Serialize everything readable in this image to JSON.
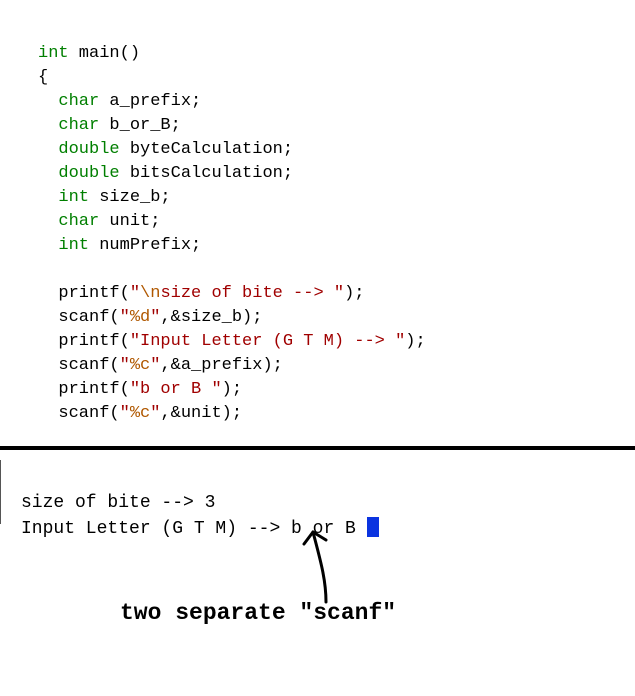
{
  "code": {
    "l1": {
      "type": "int",
      "rest": " main()"
    },
    "l2": "{",
    "l3": {
      "type": "char",
      "rest": " a_prefix;"
    },
    "l4": {
      "type": "char",
      "rest": " b_or_B;"
    },
    "l5": {
      "type": "double",
      "rest": " byteCalculation;"
    },
    "l6": {
      "type": "double",
      "rest": " bitsCalculation;"
    },
    "l7": {
      "type": "int",
      "rest": " size_b;"
    },
    "l8": {
      "type": "char",
      "rest": " unit;"
    },
    "l9": {
      "type": "int",
      "rest": " numPrefix;"
    },
    "l10": {
      "fn": "printf",
      "open": "(",
      "q1": "\"",
      "esc1": "\\n",
      "str1": "size of bite --> ",
      "q2": "\"",
      "close": ");"
    },
    "l11": {
      "fn": "scanf",
      "open": "(",
      "q1": "\"",
      "fmt": "%d",
      "q2": "\"",
      "rest": ",&size_b);"
    },
    "l12": {
      "fn": "printf",
      "open": "(",
      "q1": "\"",
      "str1": "Input Letter (G T M) --> ",
      "q2": "\"",
      "close": ");"
    },
    "l13": {
      "fn": "scanf",
      "open": "(",
      "q1": "\"",
      "fmt": "%c",
      "q2": "\"",
      "rest": ",&a_prefix);"
    },
    "l14": {
      "fn": "printf",
      "open": "(",
      "q1": "\"",
      "str1": "b or B ",
      "q2": "\"",
      "close": ");"
    },
    "l15": {
      "fn": "scanf",
      "open": "(",
      "q1": "\"",
      "fmt": "%c",
      "q2": "\"",
      "rest": ",&unit);"
    }
  },
  "console": {
    "line1": "size of bite --> 3",
    "line2": "Input Letter (G T M) --> b or B "
  },
  "annotation": {
    "text": "two separate \"scanf\""
  }
}
